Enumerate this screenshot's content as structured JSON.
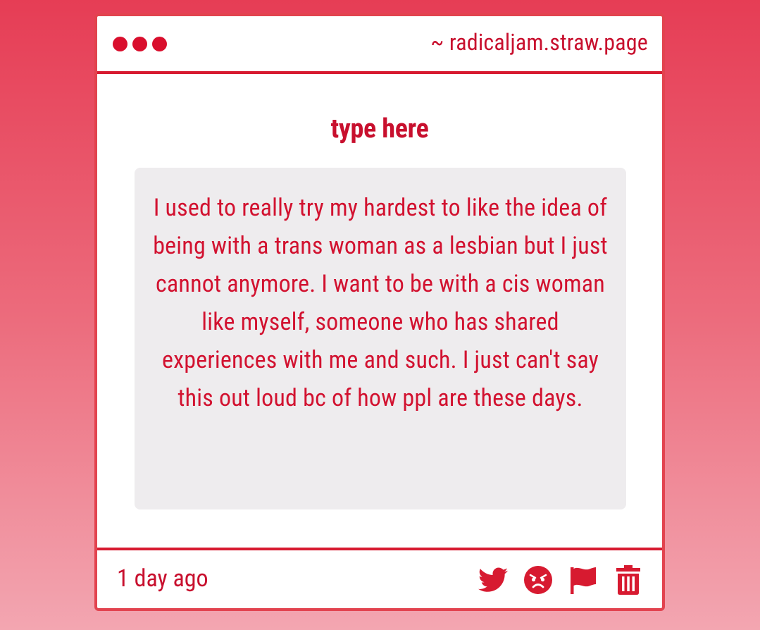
{
  "window": {
    "url": "~ radicaljam.straw.page"
  },
  "main": {
    "heading": "type here",
    "message": "I used to really try my hardest to like the idea of being with a trans woman as a lesbian but I just cannot anymore. I want to be with a cis woman like myself, someone who has shared experiences with me and such. I just can't say this out loud bc of how ppl are these days."
  },
  "footer": {
    "timestamp": "1 day ago",
    "actions": [
      {
        "icon": "twitter-icon"
      },
      {
        "icon": "angry-face-icon"
      },
      {
        "icon": "flag-icon"
      },
      {
        "icon": "trash-icon"
      }
    ]
  },
  "colors": {
    "accent": "#d71a30",
    "background_top": "#e63d55",
    "background_bottom": "#f3a6b1",
    "card": "#ffffff",
    "message_box": "#eeecee"
  }
}
